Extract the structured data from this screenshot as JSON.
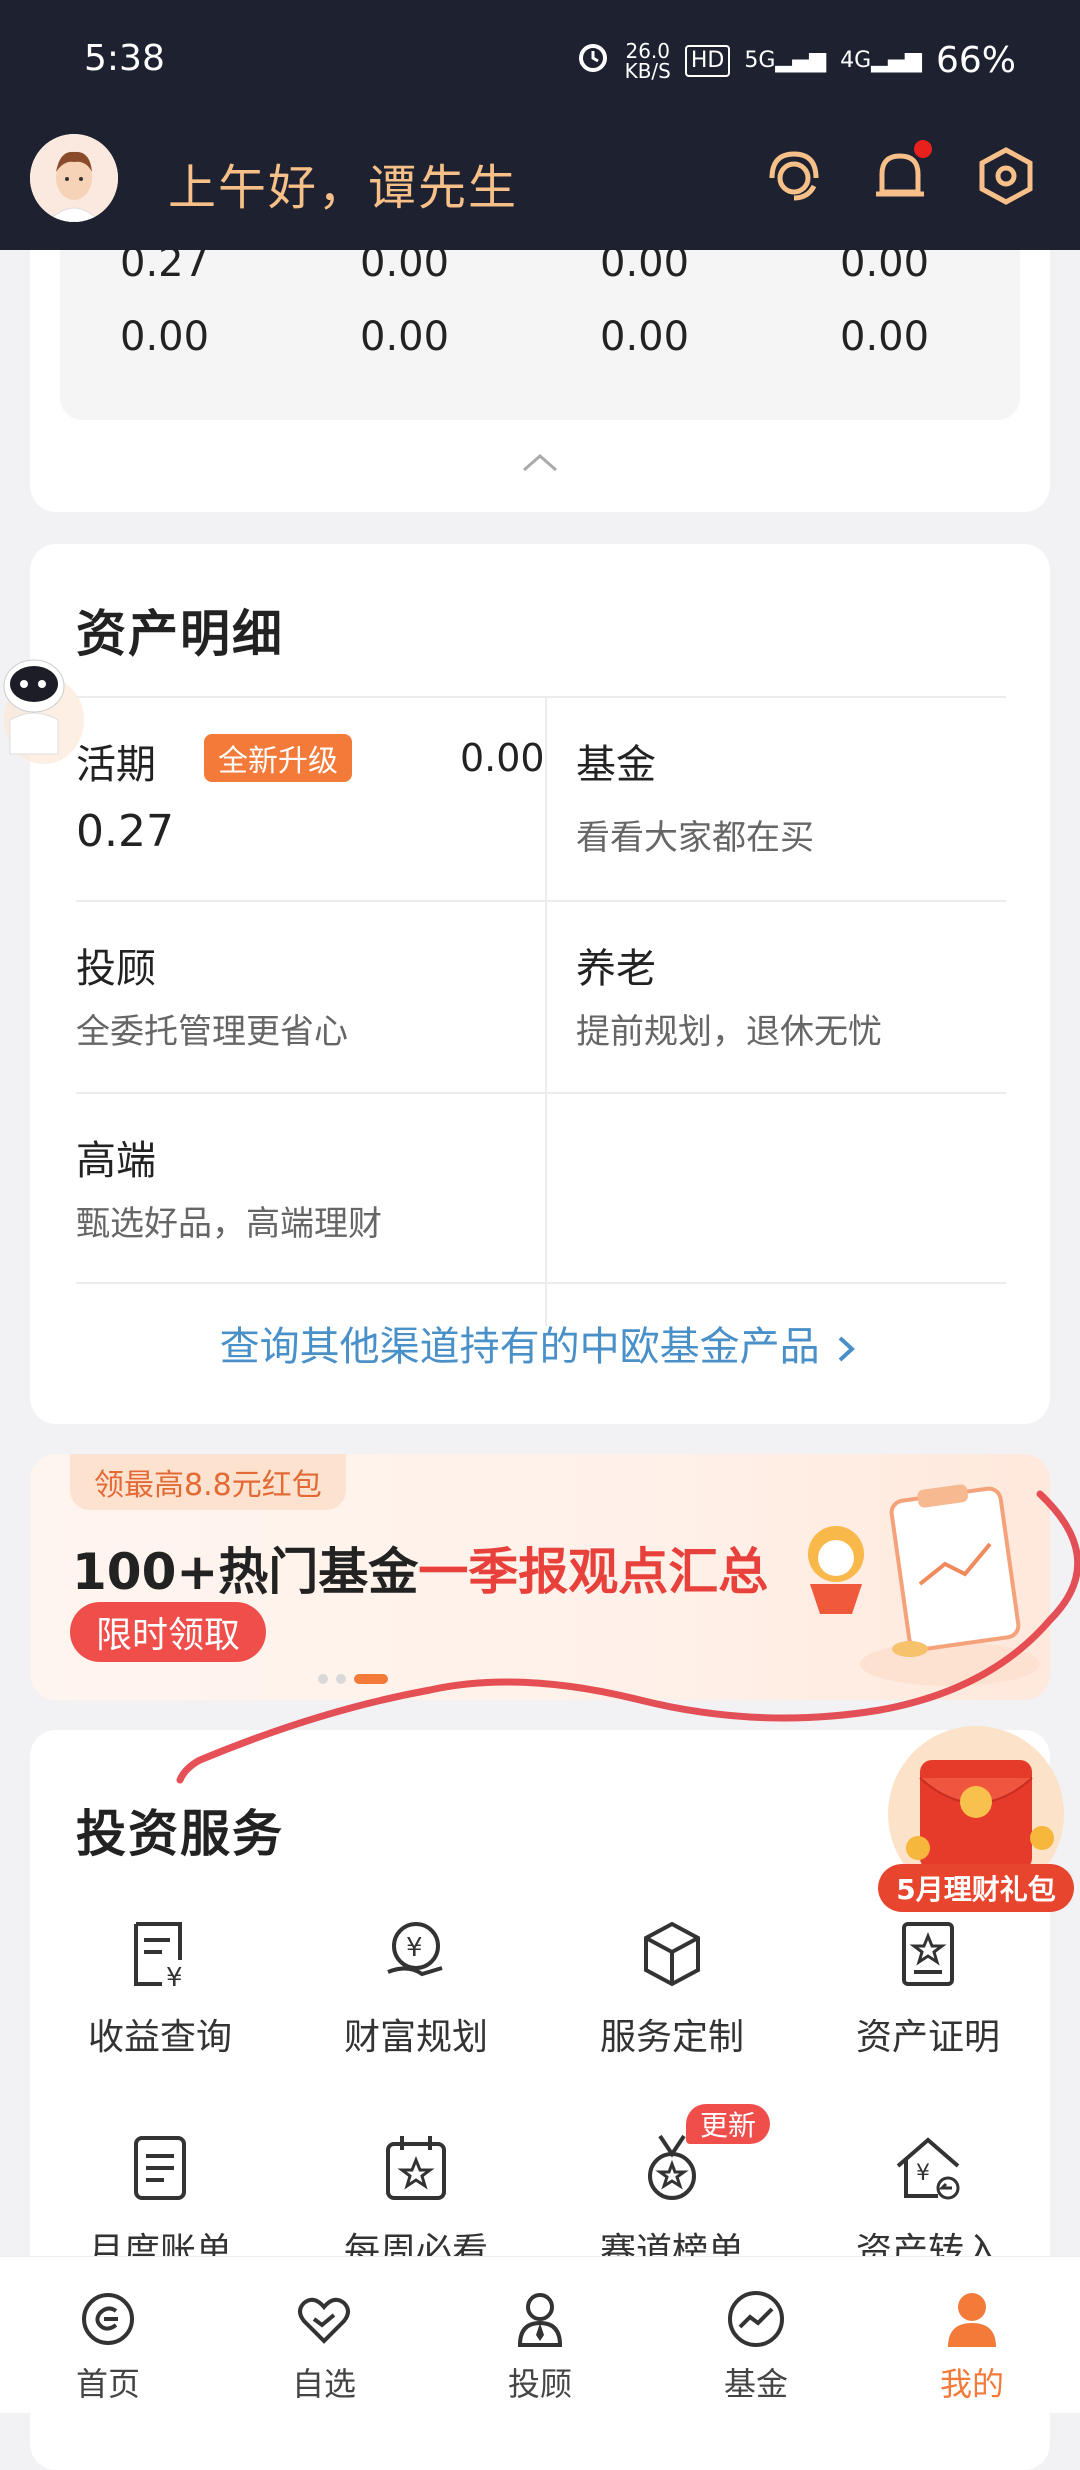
{
  "status_bar": {
    "time": "5:38",
    "net_speed": "26.0",
    "net_unit": "KB/S",
    "hd": "HD",
    "sig1": "5G",
    "sig2": "4G",
    "battery": "66%"
  },
  "header": {
    "greeting": "上午好，谭先生"
  },
  "top_values": {
    "row1": [
      "0.27",
      "0.00",
      "0.00",
      "0.00"
    ],
    "row2": [
      "0.00",
      "0.00",
      "0.00",
      "0.00"
    ]
  },
  "assets": {
    "title": "资产明细",
    "current": {
      "label": "活期",
      "badge": "全新升级",
      "value1": "0.00",
      "value2": "0.27"
    },
    "fund": {
      "label": "基金",
      "sub": "看看大家都在买"
    },
    "advisor": {
      "label": "投顾",
      "sub": "全委托管理更省心"
    },
    "pension": {
      "label": "养老",
      "sub": "提前规划，退休无忧"
    },
    "premium": {
      "label": "高端",
      "sub": "甄选好品，高端理财"
    },
    "query_link": "查询其他渠道持有的中欧基金产品"
  },
  "banner": {
    "tag": "领最高8.8元红包",
    "main_black": "100+热门基金",
    "main_red": "一季报观点汇总",
    "button": "限时领取"
  },
  "services": {
    "title": "投资服务",
    "items": [
      {
        "label": "收益查询",
        "icon": "receipt-yen-icon"
      },
      {
        "label": "财富规划",
        "icon": "money-hand-icon"
      },
      {
        "label": "服务定制",
        "icon": "cube-icon"
      },
      {
        "label": "资产证明",
        "icon": "certificate-icon"
      },
      {
        "label": "月度账单",
        "icon": "document-icon"
      },
      {
        "label": "每周必看",
        "icon": "calendar-star-icon"
      },
      {
        "label": "赛道榜单",
        "icon": "medal-icon",
        "badge": "更新"
      },
      {
        "label": "资产转入",
        "icon": "house-yen-icon"
      }
    ]
  },
  "gift": {
    "label": "5月理财礼包"
  },
  "tabs": [
    {
      "label": "首页",
      "icon": "home-icon"
    },
    {
      "label": "自选",
      "icon": "heart-icon"
    },
    {
      "label": "投顾",
      "icon": "advisor-icon"
    },
    {
      "label": "基金",
      "icon": "trend-icon"
    },
    {
      "label": "我的",
      "icon": "profile-icon",
      "active": true
    }
  ],
  "colors": {
    "header_bg": "#1e2130",
    "accent": "#f47a3a",
    "link": "#4a90c8",
    "active_tab": "#f47a3a",
    "banner_red": "#e8413b"
  }
}
